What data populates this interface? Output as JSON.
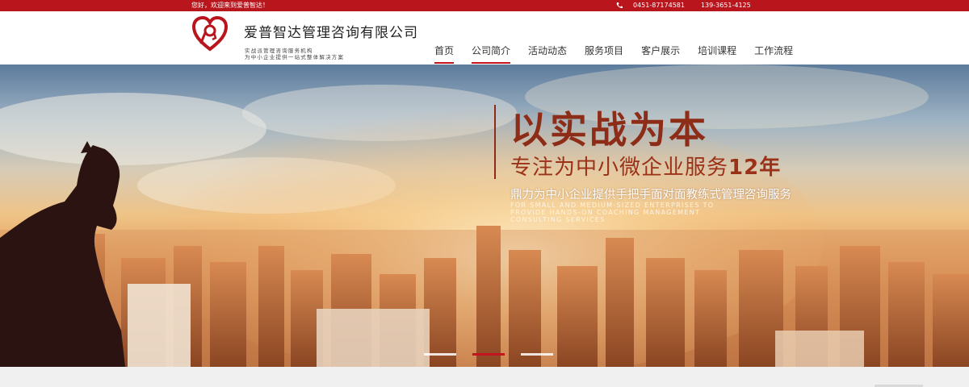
{
  "topbar": {
    "welcome": "您好，欢迎来到爱普智达！",
    "phone1": "0451-87174581",
    "phone2": "139-3651-4125"
  },
  "header": {
    "company_name": "爱普智达管理咨询有限公司",
    "slogan_line1": "实战派管理咨询服务机构",
    "slogan_line2": "为中小企业提供一站式整体解决方案"
  },
  "nav": {
    "items": [
      {
        "label": "首页",
        "active": true
      },
      {
        "label": "公司简介",
        "active": true
      },
      {
        "label": "活动动态",
        "active": false
      },
      {
        "label": "服务项目",
        "active": false
      },
      {
        "label": "客户展示",
        "active": false
      },
      {
        "label": "培训课程",
        "active": false
      },
      {
        "label": "工作流程",
        "active": false
      }
    ]
  },
  "banner": {
    "headline": "以实战为本",
    "subline_main": "专注为中小微企业服务",
    "subline_number": "12年",
    "description": "鼎力为中小企业提供手把手面对面教练式管理咨询服务",
    "english": "FOR SMALL AND MEDIUM-SIZED ENTERPRISES TO PROVIDE HANDS-ON COACHING MANAGEMENT CONSULTING SERVICES"
  },
  "slider": {
    "count": 3,
    "active_index": 1
  },
  "colors": {
    "brand_red": "#b8151d",
    "headline_brown": "#8e2d17"
  },
  "icons": {
    "phone": "phone-icon",
    "logo": "heart-logo-icon"
  }
}
